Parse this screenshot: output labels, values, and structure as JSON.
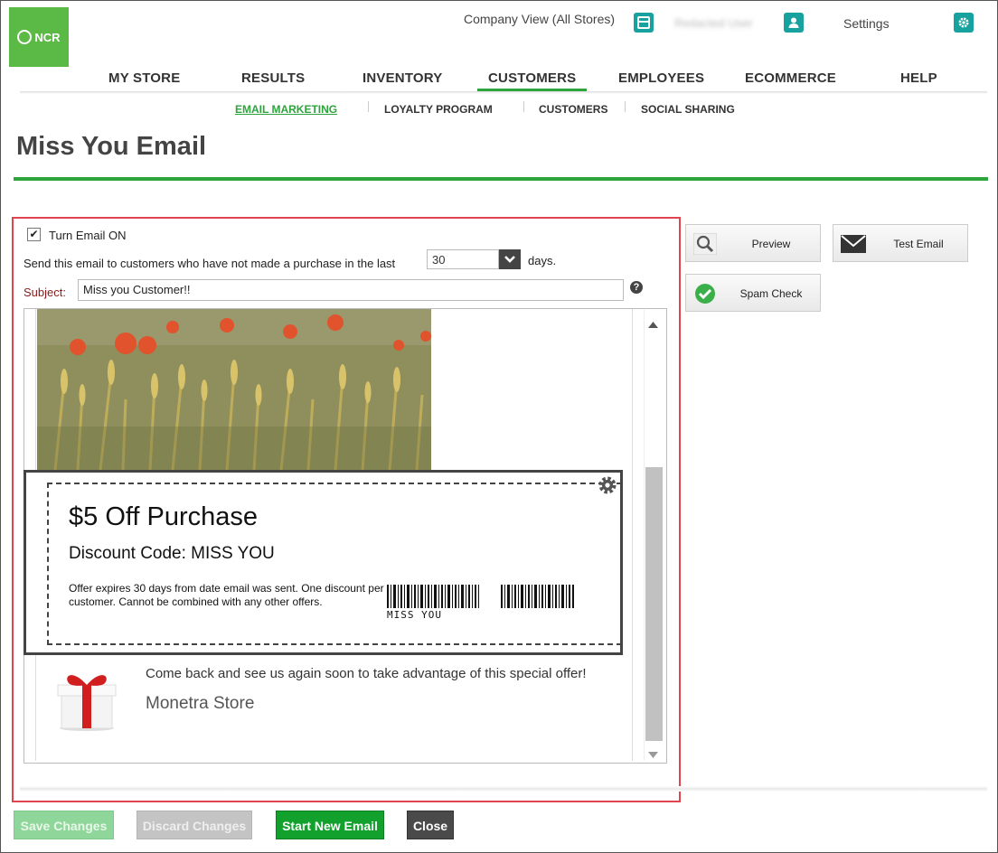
{
  "header": {
    "logo_text": "NCR",
    "company_view": "Company View (All Stores)",
    "user_name": "Redacted User",
    "settings": "Settings"
  },
  "main_nav": [
    "MY STORE",
    "RESULTS",
    "INVENTORY",
    "CUSTOMERS",
    "EMPLOYEES",
    "ECOMMERCE",
    "HELP"
  ],
  "sub_nav": [
    "EMAIL MARKETING",
    "LOYALTY PROGRAM",
    "CUSTOMERS",
    "SOCIAL SHARING"
  ],
  "page_title": "Miss You Email",
  "form": {
    "turn_on_label": "Turn Email ON",
    "turn_on_checked": true,
    "send_label": "Send this email to customers who have not made a purchase in the last",
    "days_value": "30",
    "days_suffix": "days.",
    "subject_label": "Subject:",
    "subject_value": "Miss you Customer!!",
    "help_glyph": "?"
  },
  "email_preview": {
    "coupon_title": "$5 Off Purchase",
    "discount_code": "Discount Code: MISS YOU",
    "fine_print": "Offer expires 30 days from date email was sent. One discount per customer. Cannot be combined with any other offers.",
    "barcode_text": "MISS YOU",
    "come_back": "Come back and see us again soon to take advantage of this special offer!",
    "store_name": "Monetra Store"
  },
  "side_buttons": {
    "preview": "Preview",
    "test_email": "Test Email",
    "spam_check": "Spam Check"
  },
  "bottom_buttons": {
    "save": "Save Changes",
    "discard": "Discard Changes",
    "start_new": "Start New Email",
    "close": "Close"
  },
  "colors": {
    "brand_green": "#2ea43d",
    "teal": "#17a2a0",
    "highlight_red": "#e0454f"
  }
}
